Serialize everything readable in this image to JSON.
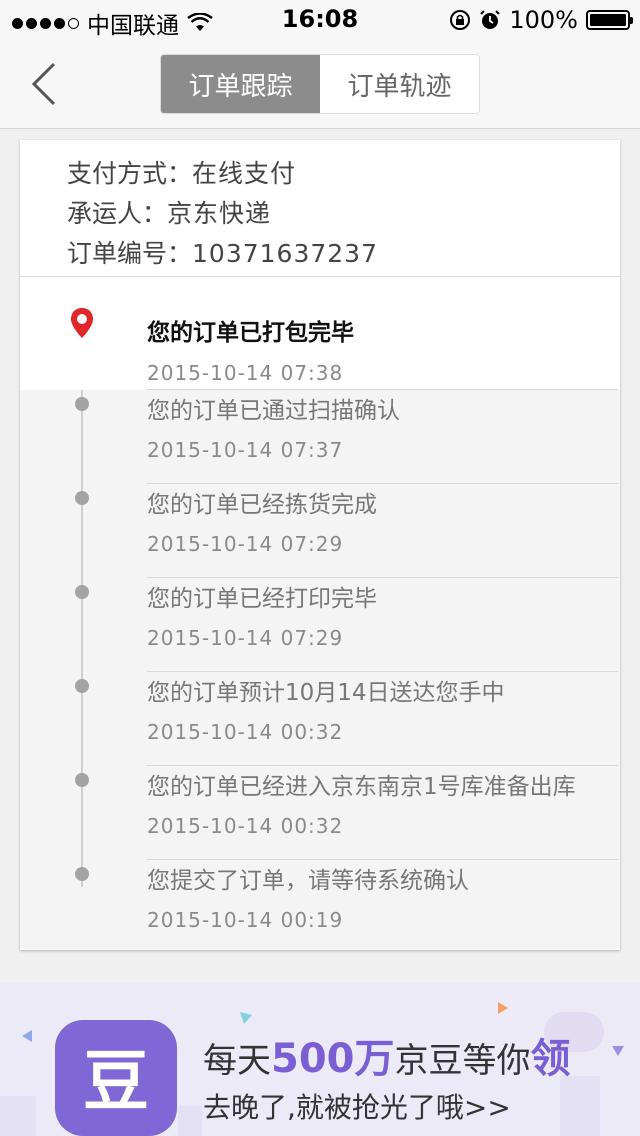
{
  "status_bar": {
    "carrier": "中国联通",
    "time": "16:08",
    "battery": "100%"
  },
  "nav": {
    "tabs": [
      {
        "label": "订单跟踪",
        "active": true
      },
      {
        "label": "订单轨迹",
        "active": false
      }
    ]
  },
  "order_info": {
    "payment_label": "支付方式：",
    "payment_value": "在线支付",
    "carrier_label": "承运人：",
    "carrier_value": "京东快递",
    "order_no_label": "订单编号：",
    "order_no_value": "10371637237"
  },
  "tracking": [
    {
      "text": "您的订单已打包完毕",
      "time": "2015-10-14 07:38",
      "current": true
    },
    {
      "text": "您的订单已通过扫描确认",
      "time": "2015-10-14 07:37"
    },
    {
      "text": "您的订单已经拣货完成",
      "time": "2015-10-14 07:29"
    },
    {
      "text": "您的订单已经打印完毕",
      "time": "2015-10-14 07:29"
    },
    {
      "text": "您的订单预计10月14日送达您手中",
      "time": "2015-10-14 00:32"
    },
    {
      "text": "您的订单已经进入京东南京1号库准备出库",
      "time": "2015-10-14 00:32"
    },
    {
      "text": "您提交了订单，请等待系统确认",
      "time": "2015-10-14 00:19"
    }
  ],
  "banner": {
    "icon_char": "豆",
    "title_pre": "每天",
    "title_num": "500万",
    "title_mid": "京豆等你",
    "title_big": "领",
    "subtitle": "去晚了,就被抢光了哦>>"
  },
  "colors": {
    "accent_purple": "#7f67d6",
    "pin_red": "#e0252b",
    "tab_active": "#8c8c8c"
  }
}
